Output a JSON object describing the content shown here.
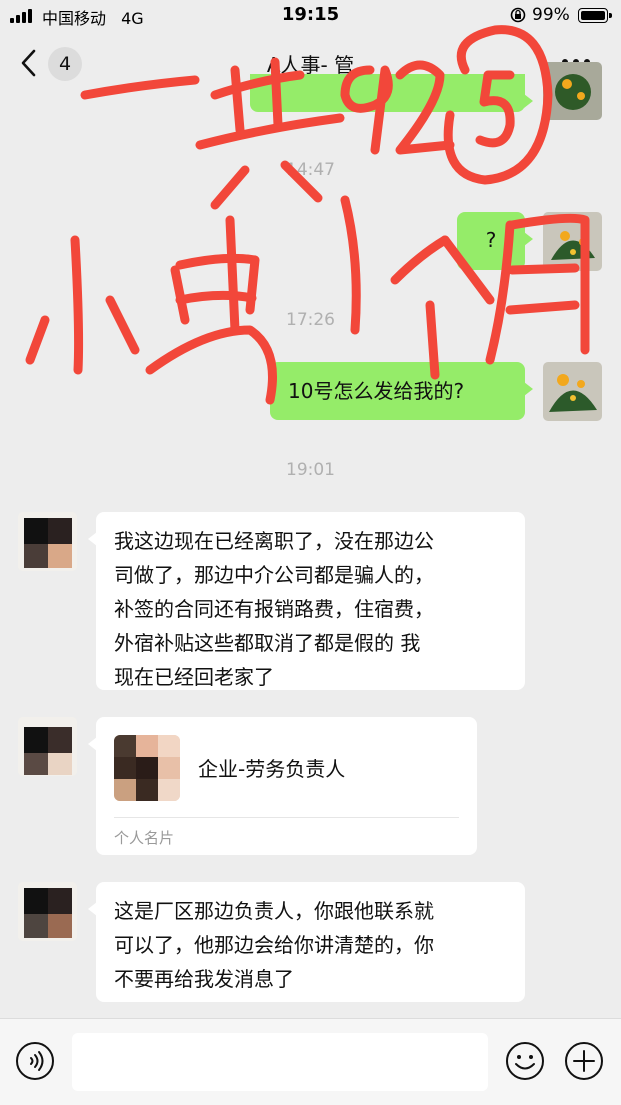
{
  "status_bar": {
    "carrier": "中国移动",
    "network": "4G",
    "time": "19:15",
    "battery": "99%"
  },
  "nav": {
    "unread_count": "4",
    "title": "A人事-    管"
  },
  "messages": {
    "time_1": "14:47",
    "out_1": "?",
    "time_2": "17:26",
    "out_2": "10号怎么发给我的?",
    "time_3": "19:01",
    "in_1": "我这边现在已经离职了，没在那边公\n司做了，那边中介公司都是骗人的，\n补签的合同还有报销路费，住宿费，\n外宿补贴这些都取消了都是假的 我\n现在已经回老家了",
    "card": {
      "name": "企业-劳务负责人",
      "type": "个人名片"
    },
    "in_2": "这是厂区那边负责人，你跟他联系就\n可以了，他那边会给你讲清楚的，你\n不要再给我发消息了"
  },
  "input_bar": {
    "placeholder": ""
  },
  "colors": {
    "chat_background": "#ededed",
    "outgoing_bubble": "#95ec69",
    "incoming_bubble": "#ffffff",
    "annotation_ink": "#f2473a"
  },
  "icons": [
    "back-icon",
    "more-icon",
    "voice-icon",
    "emoji-icon",
    "plus-icon",
    "lock-rotation-icon",
    "signal-icon",
    "battery-icon"
  ]
}
